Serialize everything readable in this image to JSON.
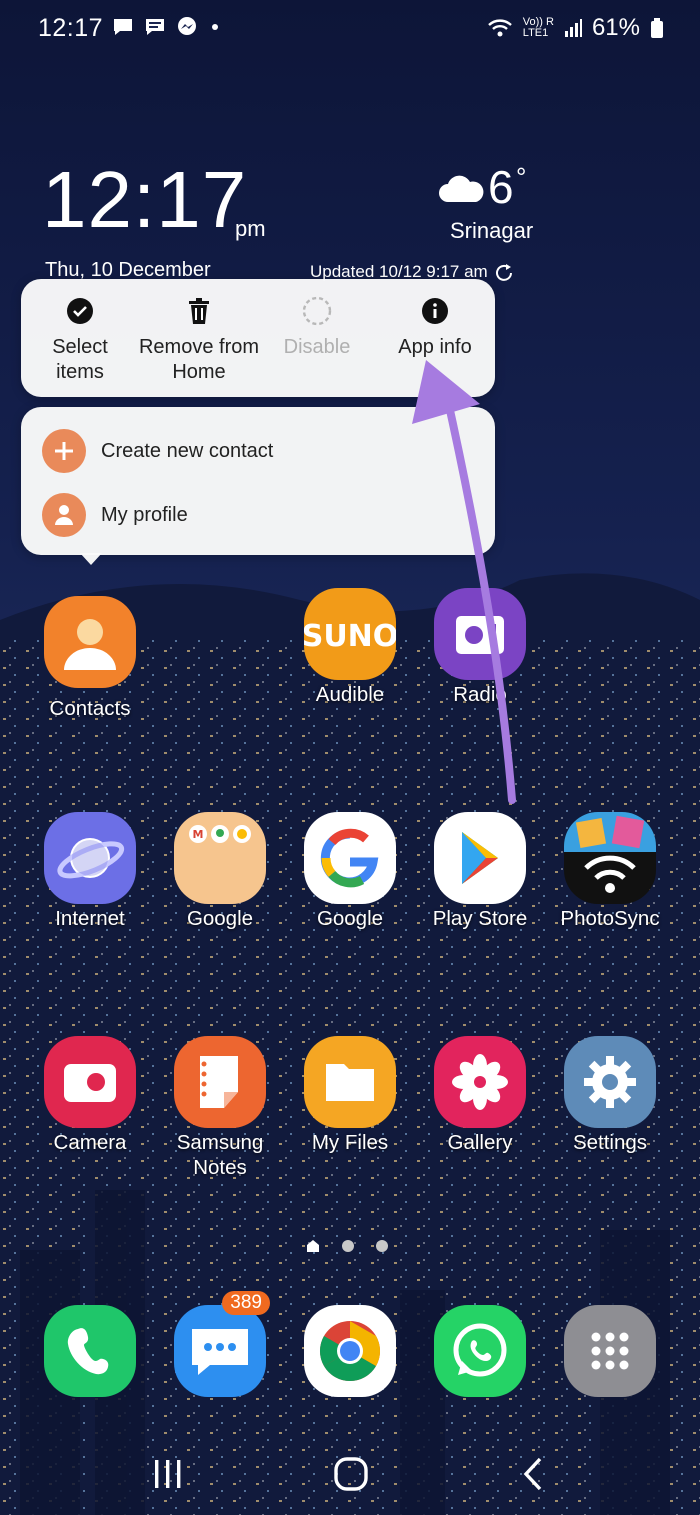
{
  "status_bar": {
    "time": "12:17",
    "notification_icons": [
      "message-icon",
      "sms-icon",
      "messenger-icon",
      "dot-icon"
    ],
    "network_label": "Vo)) R\nLTE1",
    "battery": "61%"
  },
  "clock_widget": {
    "time": "12:17",
    "ampm": "pm",
    "date": "Thu, 10 December",
    "temperature": "6",
    "degree": "°",
    "city": "Srinagar",
    "updated": "Updated 10/12 9:17 am"
  },
  "context_menu": {
    "actions": [
      {
        "label": "Select items",
        "icon": "check-circle-icon",
        "enabled": true
      },
      {
        "label": "Remove from Home",
        "icon": "trash-icon",
        "enabled": true
      },
      {
        "label": "Disable",
        "icon": "dashed-circle-icon",
        "enabled": false
      },
      {
        "label": "App info",
        "icon": "info-icon",
        "enabled": true
      }
    ],
    "shortcuts": [
      {
        "label": "Create new contact",
        "icon": "plus-icon"
      },
      {
        "label": "My profile",
        "icon": "person-icon"
      }
    ]
  },
  "apps": {
    "row1": [
      {
        "label": "Contacts",
        "icon": "contacts-icon"
      },
      {
        "label": "Audible",
        "icon": "audible-icon"
      },
      {
        "label": "Radio",
        "icon": "radio-icon"
      }
    ],
    "row2": [
      {
        "label": "Internet",
        "icon": "internet-icon"
      },
      {
        "label": "Google",
        "icon": "google-folder-icon"
      },
      {
        "label": "Google",
        "icon": "google-icon"
      },
      {
        "label": "Play Store",
        "icon": "play-store-icon"
      },
      {
        "label": "PhotoSync",
        "icon": "photosync-icon"
      }
    ],
    "row3": [
      {
        "label": "Camera",
        "icon": "camera-icon"
      },
      {
        "label": "Samsung Notes",
        "icon": "notes-icon"
      },
      {
        "label": "My Files",
        "icon": "folder-icon"
      },
      {
        "label": "Gallery",
        "icon": "gallery-icon"
      },
      {
        "label": "Settings",
        "icon": "settings-icon"
      }
    ]
  },
  "dock": [
    {
      "icon": "phone-icon"
    },
    {
      "icon": "messages-icon",
      "badge": "389"
    },
    {
      "icon": "chrome-icon"
    },
    {
      "icon": "whatsapp-icon"
    },
    {
      "icon": "app-drawer-icon"
    }
  ],
  "page_indicator": {
    "pages": 3,
    "current": 1
  },
  "nav_bar": [
    "recents-icon",
    "home-icon",
    "back-icon"
  ],
  "colors": {
    "accent_arrow": "#a67be0",
    "shortcut_icon_bg": "#e98a5a"
  }
}
